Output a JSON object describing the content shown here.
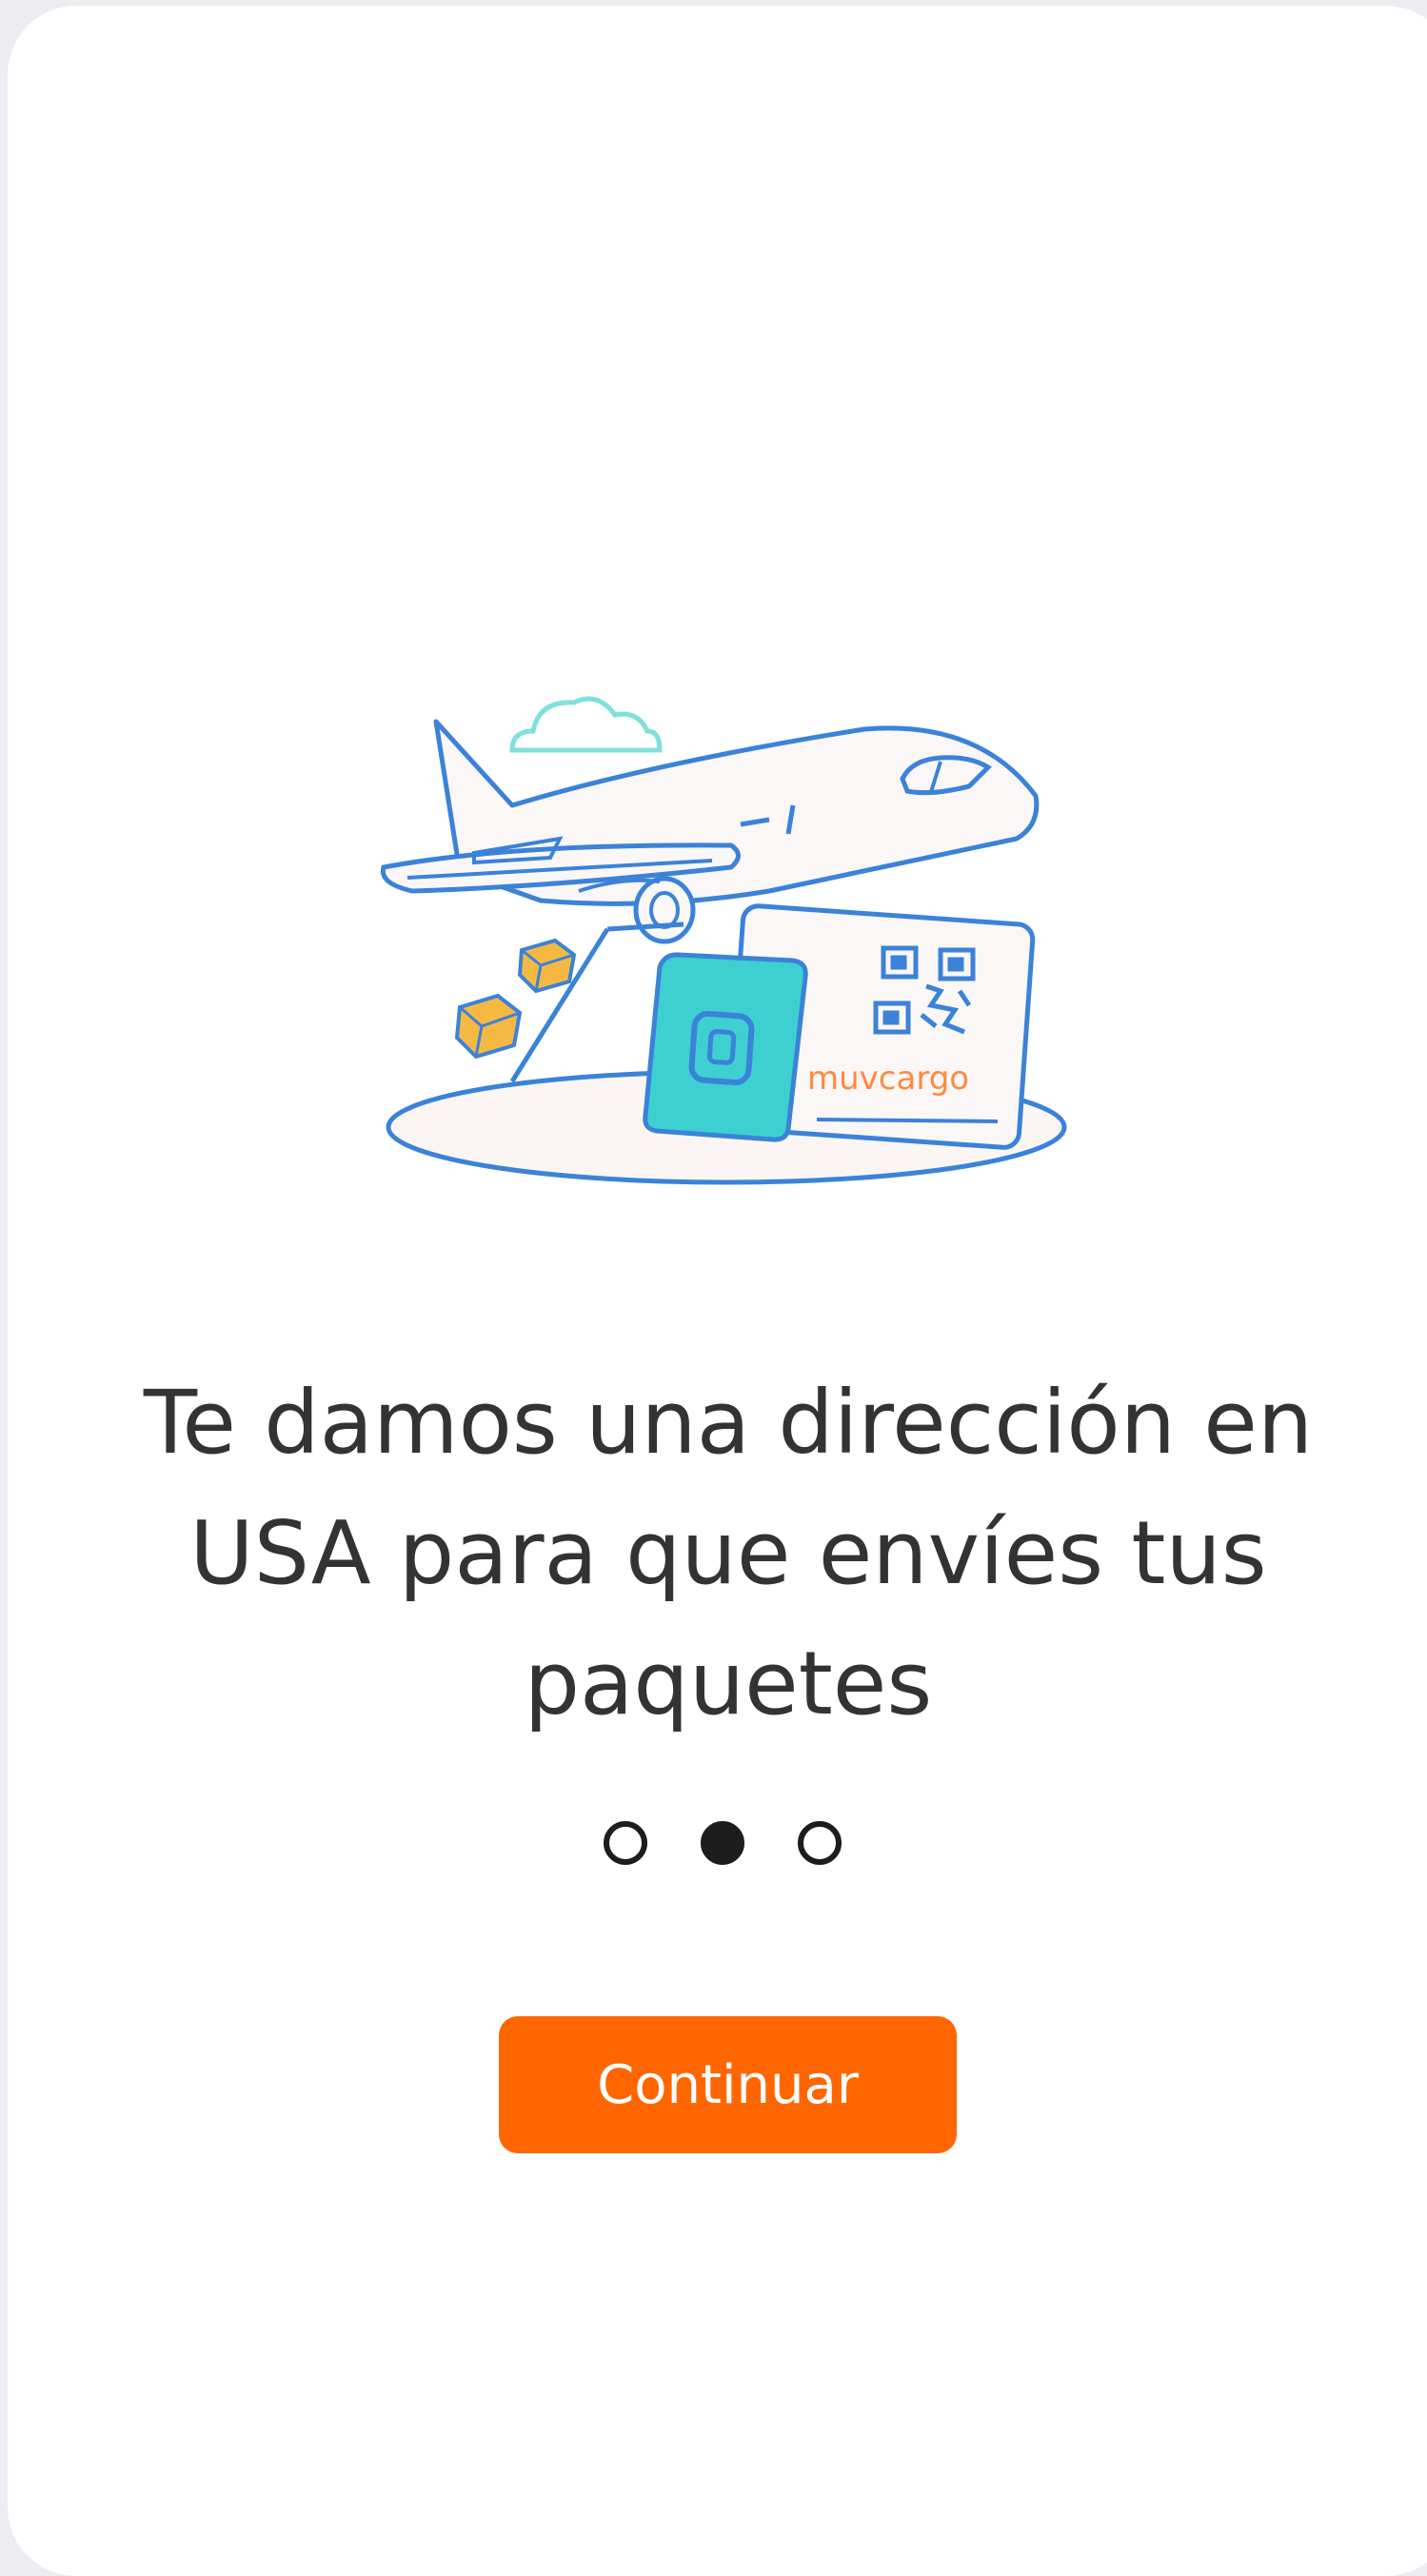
{
  "onboarding": {
    "title_lines": [
      "Te damos una dirección en",
      "USA para que envíes tus",
      "paquetes"
    ],
    "brand_text": "muvcargo",
    "illustration": "airplane-with-packages-and-qr-card",
    "pager": {
      "total": 3,
      "active_index": 1
    },
    "continue_label": "Continuar"
  },
  "colors": {
    "background": "#ececf1",
    "card": "#ffffff",
    "accent": "#ff6600",
    "text": "#333333",
    "illustration_line": "#3b82d9",
    "illustration_teal": "#3ed0d0",
    "illustration_box": "#f5b942",
    "cloud": "#7fe0dc"
  }
}
